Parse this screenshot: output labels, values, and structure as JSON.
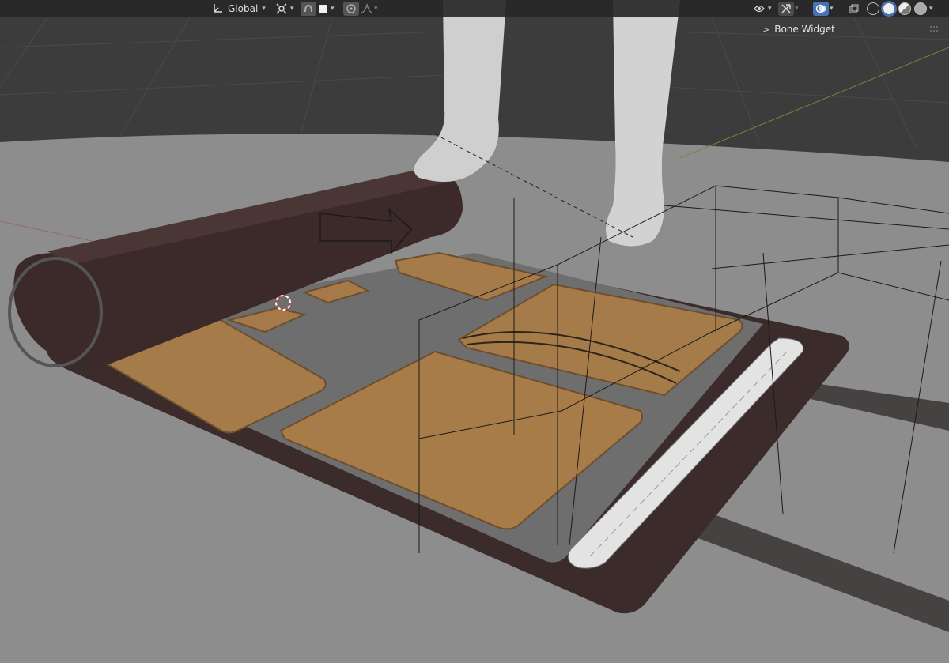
{
  "header": {
    "transform_orientation": "Global",
    "icons": {
      "orientation": "transform-orientation-icon",
      "pivot": "pivot-point-icon",
      "snap": "snap-icon",
      "snap_target": "snap-target-icon",
      "proportional": "proportional-editing-icon",
      "falloff": "falloff-curve-icon",
      "visibility": "visibility-icon",
      "gizmo": "gizmo-icon",
      "overlay": "overlay-icon",
      "xray": "xray-icon",
      "wireframe_shading": "wireframe-shading-icon",
      "solid_shading": "solid-shading-icon",
      "material_shading": "material-preview-icon",
      "rendered_shading": "rendered-shading-icon"
    }
  },
  "sidebar_panel": {
    "title": "Bone Widget"
  },
  "colors": {
    "accent": "#4772b3",
    "floor": "#8a8a8a",
    "mat_dark": "#3a2c2b",
    "pad_tan": "#a57b4a",
    "strap_white": "#e0e0e0"
  }
}
